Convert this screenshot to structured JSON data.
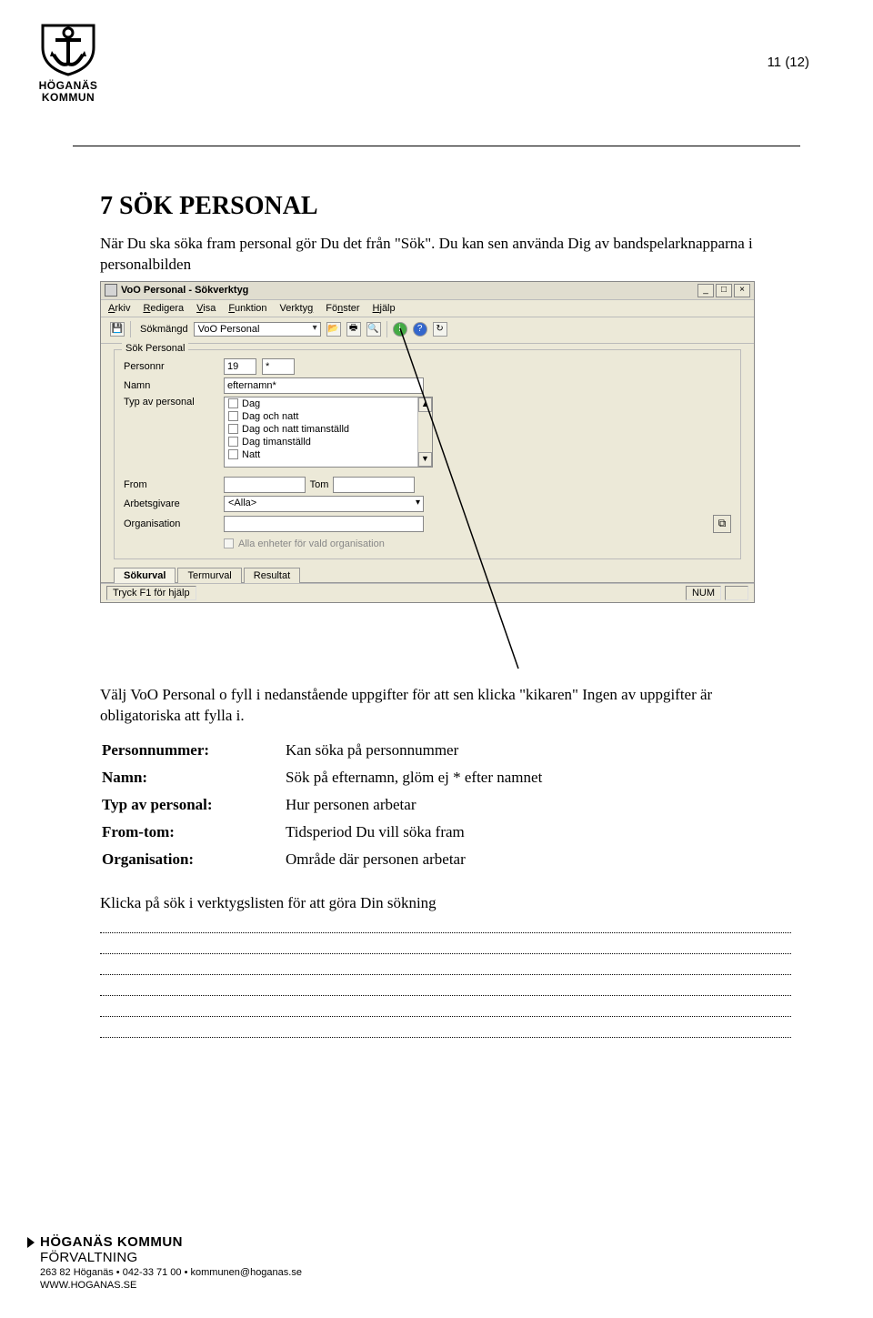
{
  "page_number": "11 (12)",
  "logo": {
    "line1": "HÖGANÄS",
    "line2": "KOMMUN"
  },
  "heading": "7  SÖK PERSONAL",
  "para1": "När Du ska söka fram personal gör Du det från \"Sök\". Du kan sen använda Dig av bandspelarknapparna i personalbilden",
  "win": {
    "title": "VoO Personal - Sökverktyg",
    "menu": [
      "Arkiv",
      "Redigera",
      "Visa",
      "Funktion",
      "Verktyg",
      "Fönster",
      "Hjälp"
    ],
    "toolbar_label": "Sökmängd",
    "toolbar_select": "VoO Personal",
    "legend": "Sök Personal",
    "fields": {
      "personnr_lbl": "Personnr",
      "personnr_val1": "19",
      "personnr_val2": "*",
      "namn_lbl": "Namn",
      "namn_val": "efternamn*",
      "typ_lbl": "Typ av personal",
      "typ_items": [
        "Dag",
        "Dag och natt",
        "Dag och natt timanställd",
        "Dag timanställd",
        "Natt"
      ],
      "from_lbl": "From",
      "tom_lbl": "Tom",
      "arbetsgivare_lbl": "Arbetsgivare",
      "arbetsgivare_val": "<Alla>",
      "organisation_lbl": "Organisation",
      "chk_label": "Alla enheter för vald organisation"
    },
    "tabs": [
      "Sökurval",
      "Termurval",
      "Resultat"
    ],
    "status_left": "Tryck F1 för hjälp",
    "status_right": "NUM"
  },
  "para2": "Välj VoO Personal o fyll i nedanstående uppgifter för att sen klicka \"kikaren\" Ingen av uppgifter är obligatoriska att fylla i.",
  "defs": [
    {
      "k": "Personnummer:",
      "v": "Kan söka på personnummer"
    },
    {
      "k": "Namn:",
      "v": "Sök på efternamn, glöm ej * efter namnet"
    },
    {
      "k": "Typ av personal:",
      "v": "Hur personen arbetar"
    },
    {
      "k": "From-tom:",
      "v": "Tidsperiod Du vill söka fram"
    },
    {
      "k": "Organisation:",
      "v": "Område där personen arbetar"
    }
  ],
  "instruction": "Klicka på sök i verktygslisten för att göra Din sökning",
  "footer": {
    "l1a": "HÖGANÄS KOMMUN",
    "l2": "FÖRVALTNING",
    "l3": "263 82 Höganäs • 042-33 71 00 • kommunen@hoganas.se",
    "l4": "WWW.HOGANAS.SE"
  }
}
